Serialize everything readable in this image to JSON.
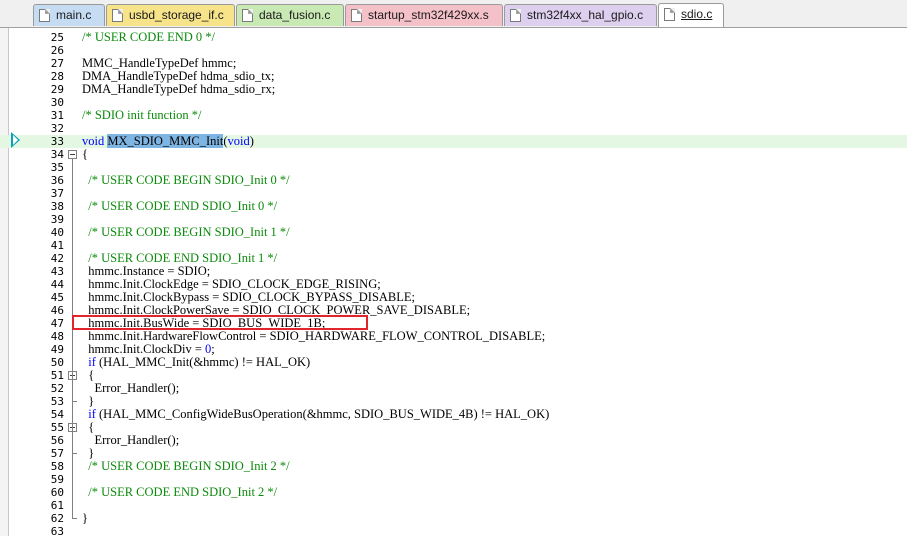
{
  "tabs": [
    {
      "label": "main.c",
      "color": "#c6dcf3",
      "icon": "c-source-file-icon",
      "active": false
    },
    {
      "label": "usbd_storage_if.c",
      "color": "#f7e38a",
      "icon": "c-source-file-locked-icon",
      "active": false
    },
    {
      "label": "data_fusion.c",
      "color": "#c9e9b4",
      "icon": "c-source-file-icon",
      "active": false
    },
    {
      "label": "startup_stm32f429xx.s",
      "color": "#f5c1c8",
      "icon": "asm-source-file-icon",
      "active": false
    },
    {
      "label": "stm32f4xx_hal_gpio.c",
      "color": "#ddd0ee",
      "icon": "c-source-file-icon",
      "active": false
    },
    {
      "label": "sdio.c",
      "color": "#ffffff",
      "icon": "c-source-file-icon",
      "active": true
    }
  ],
  "editor": {
    "current_line": 33,
    "execution_marker_line": 33,
    "highlight_box_line": 47,
    "highlight_box_color": "#e0262a",
    "comment_color": "#0a8a0a",
    "keyword_color": "#0000ff",
    "lines": [
      {
        "num": "25",
        "tokens": [
          {
            "t": "/* USER CODE END 0 */",
            "k": "comment"
          }
        ]
      },
      {
        "num": "26",
        "tokens": []
      },
      {
        "num": "27",
        "tokens": [
          {
            "t": "MMC_HandleTypeDef hmmc;",
            "k": "plain"
          }
        ]
      },
      {
        "num": "28",
        "tokens": [
          {
            "t": "DMA_HandleTypeDef hdma_sdio_tx;",
            "k": "plain"
          }
        ]
      },
      {
        "num": "29",
        "tokens": [
          {
            "t": "DMA_HandleTypeDef hdma_sdio_rx;",
            "k": "plain"
          }
        ]
      },
      {
        "num": "30",
        "tokens": []
      },
      {
        "num": "31",
        "tokens": [
          {
            "t": "/* SDIO init function */",
            "k": "comment"
          }
        ]
      },
      {
        "num": "32",
        "tokens": []
      },
      {
        "num": "33",
        "tokens": [
          {
            "t": "void ",
            "k": "keyword"
          },
          {
            "t": "MX_SDIO_MMC_Init",
            "k": "sel"
          },
          {
            "t": "(",
            "k": "plain"
          },
          {
            "t": "void",
            "k": "keyword"
          },
          {
            "t": ")",
            "k": "plain"
          }
        ]
      },
      {
        "num": "34",
        "tokens": [
          {
            "t": "{",
            "k": "plain"
          }
        ],
        "fold": "open"
      },
      {
        "num": "35",
        "tokens": []
      },
      {
        "num": "36",
        "tokens": [
          {
            "t": "  /* USER CODE BEGIN SDIO_Init 0 */",
            "k": "comment"
          }
        ]
      },
      {
        "num": "37",
        "tokens": []
      },
      {
        "num": "38",
        "tokens": [
          {
            "t": "  /* USER CODE END SDIO_Init 0 */",
            "k": "comment"
          }
        ]
      },
      {
        "num": "39",
        "tokens": []
      },
      {
        "num": "40",
        "tokens": [
          {
            "t": "  /* USER CODE BEGIN SDIO_Init 1 */",
            "k": "comment"
          }
        ]
      },
      {
        "num": "41",
        "tokens": []
      },
      {
        "num": "42",
        "tokens": [
          {
            "t": "  /* USER CODE END SDIO_Init 1 */",
            "k": "comment"
          }
        ]
      },
      {
        "num": "43",
        "tokens": [
          {
            "t": "  hmmc.Instance = SDIO;",
            "k": "plain"
          }
        ]
      },
      {
        "num": "44",
        "tokens": [
          {
            "t": "  hmmc.Init.ClockEdge = SDIO_CLOCK_EDGE_RISING;",
            "k": "plain"
          }
        ]
      },
      {
        "num": "45",
        "tokens": [
          {
            "t": "  hmmc.Init.ClockBypass = SDIO_CLOCK_BYPASS_DISABLE;",
            "k": "plain"
          }
        ]
      },
      {
        "num": "46",
        "tokens": [
          {
            "t": "  hmmc.Init.ClockPowerSave = SDIO_CLOCK_POWER_SAVE_DISABLE;",
            "k": "plain"
          }
        ]
      },
      {
        "num": "47",
        "tokens": [
          {
            "t": "  hmmc.Init.BusWide = SDIO_BUS_WIDE_1B;",
            "k": "plain"
          }
        ]
      },
      {
        "num": "48",
        "tokens": [
          {
            "t": "  hmmc.Init.HardwareFlowControl = SDIO_HARDWARE_FLOW_CONTROL_DISABLE;",
            "k": "plain"
          }
        ]
      },
      {
        "num": "49",
        "tokens": [
          {
            "t": "  hmmc.Init.ClockDiv = ",
            "k": "plain"
          },
          {
            "t": "0",
            "k": "number"
          },
          {
            "t": ";",
            "k": "plain"
          }
        ]
      },
      {
        "num": "50",
        "tokens": [
          {
            "t": "  if ",
            "k": "keyword"
          },
          {
            "t": "(HAL_MMC_Init(&hmmc) != HAL_OK)",
            "k": "plain"
          }
        ]
      },
      {
        "num": "51",
        "tokens": [
          {
            "t": "  {",
            "k": "plain"
          }
        ],
        "fold": "open"
      },
      {
        "num": "52",
        "tokens": [
          {
            "t": "    Error_Handler();",
            "k": "plain"
          }
        ]
      },
      {
        "num": "53",
        "tokens": [
          {
            "t": "  }",
            "k": "plain"
          }
        ],
        "fold": "end"
      },
      {
        "num": "54",
        "tokens": [
          {
            "t": "  if ",
            "k": "keyword"
          },
          {
            "t": "(HAL_MMC_ConfigWideBusOperation(&hmmc, SDIO_BUS_WIDE_4B) != HAL_OK)",
            "k": "plain"
          }
        ]
      },
      {
        "num": "55",
        "tokens": [
          {
            "t": "  {",
            "k": "plain"
          }
        ],
        "fold": "open"
      },
      {
        "num": "56",
        "tokens": [
          {
            "t": "    Error_Handler();",
            "k": "plain"
          }
        ]
      },
      {
        "num": "57",
        "tokens": [
          {
            "t": "  }",
            "k": "plain"
          }
        ],
        "fold": "end"
      },
      {
        "num": "58",
        "tokens": [
          {
            "t": "  /* USER CODE BEGIN SDIO_Init 2 */",
            "k": "comment"
          }
        ]
      },
      {
        "num": "59",
        "tokens": []
      },
      {
        "num": "60",
        "tokens": [
          {
            "t": "  /* USER CODE END SDIO_Init 2 */",
            "k": "comment"
          }
        ]
      },
      {
        "num": "61",
        "tokens": []
      },
      {
        "num": "62",
        "tokens": [
          {
            "t": "}",
            "k": "plain"
          }
        ],
        "fold": "end"
      },
      {
        "num": "63",
        "tokens": []
      }
    ]
  }
}
